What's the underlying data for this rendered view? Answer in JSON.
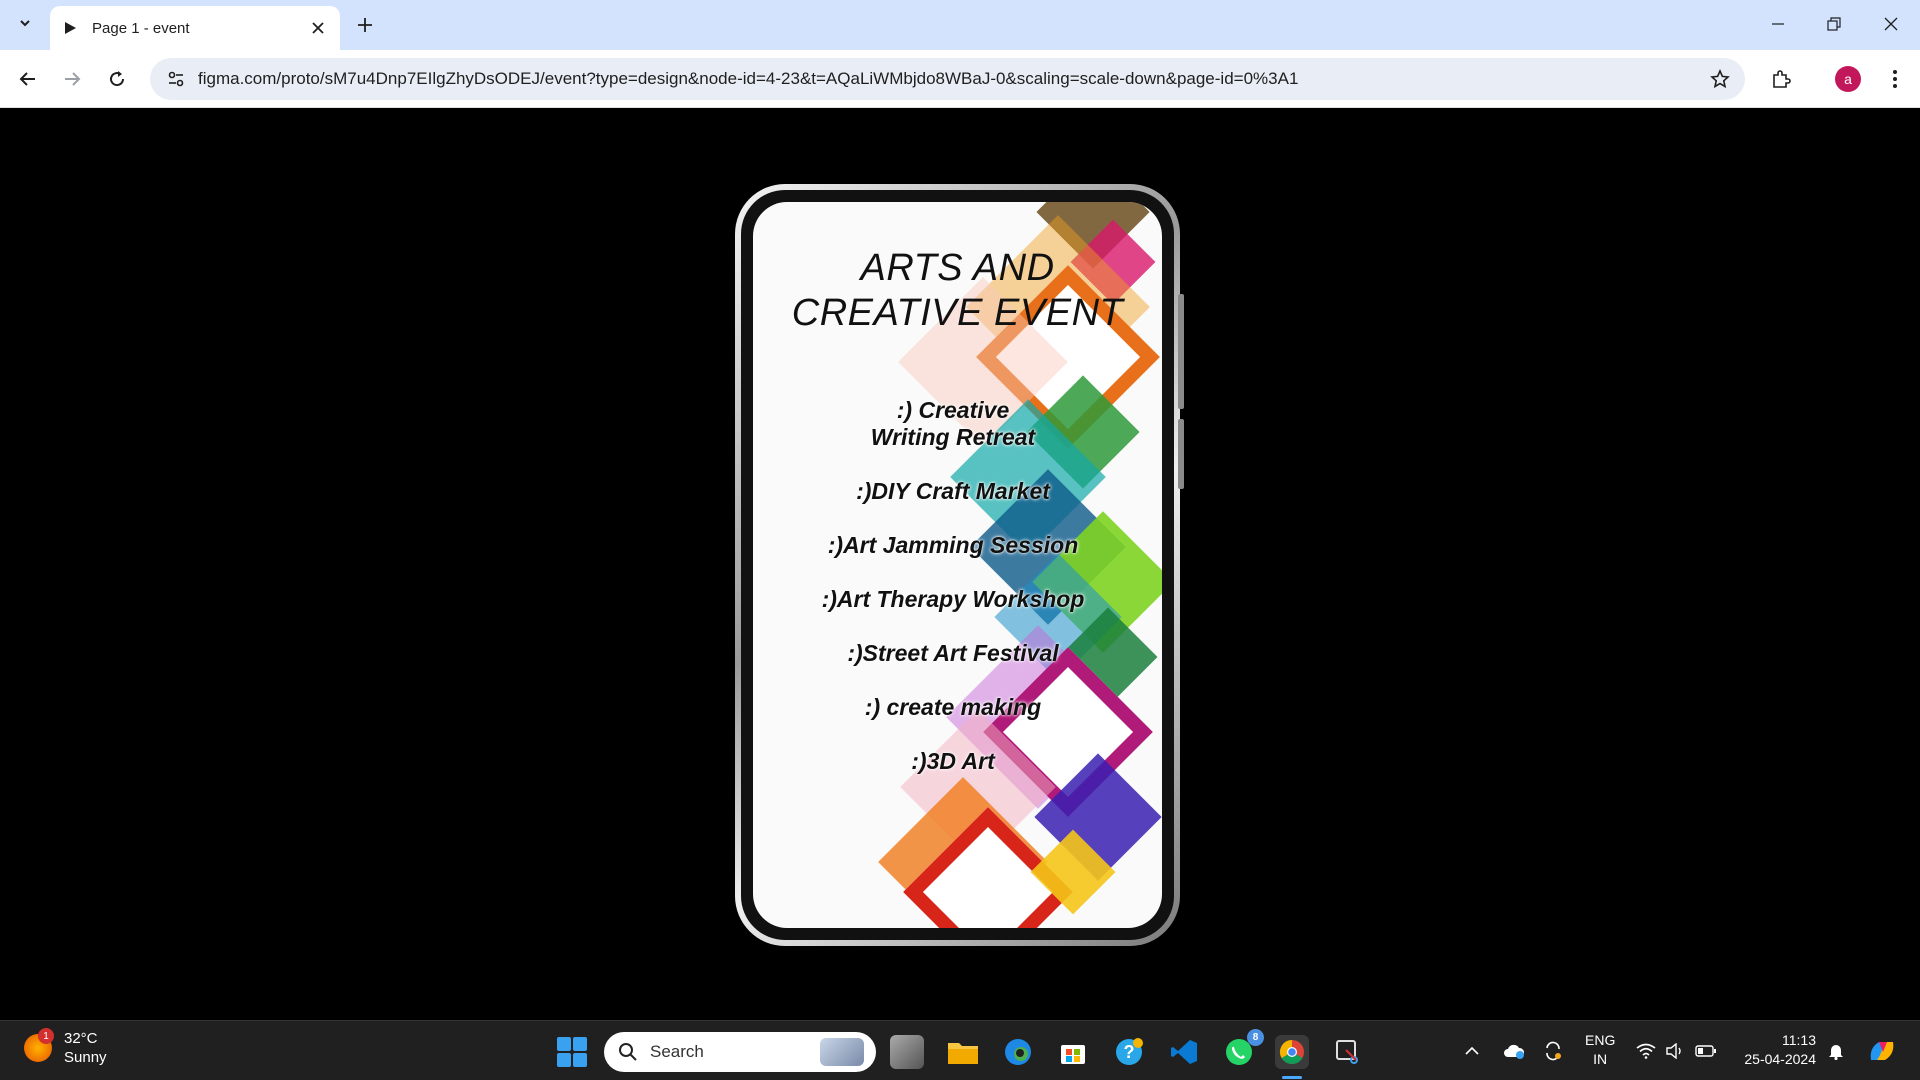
{
  "browser": {
    "tab_title": "Page 1 - event",
    "url": "figma.com/proto/sM7u4Dnp7EIlgZhyDsODEJ/event?type=design&node-id=4-23&t=AQaLiWMbjdo8WBaJ-0&scaling=scale-down&page-id=0%3A1",
    "profile_initial": "a"
  },
  "event": {
    "title_line1": "ARTS AND",
    "title_line2": "CREATIVE EVENT",
    "items": [
      ":) Creative Writing Retreat",
      ":)DIY Craft Market",
      ":)Art Jamming Session",
      ":)Art Therapy Workshop",
      ":)Street Art Festival",
      ":) create making",
      ":)3D Art"
    ]
  },
  "taskbar": {
    "weather_temp": "32°C",
    "weather_cond": "Sunny",
    "weather_badge": "1",
    "search_label": "Search",
    "whatsapp_badge": "8",
    "lang_line1": "ENG",
    "lang_line2": "IN",
    "time": "11:13",
    "date": "25-04-2024"
  }
}
